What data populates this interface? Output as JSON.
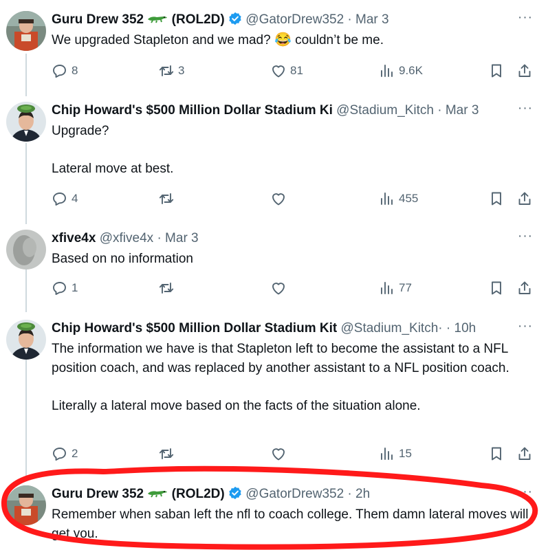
{
  "tweets": [
    {
      "name": "Guru Drew 352",
      "handle_suffix": "(ROL2D)",
      "handle": "@GatorDrew352",
      "time": "· Mar 3",
      "text_before_emoji": "We upgraded Stapleton and we mad? ",
      "emoji": "😂",
      "text_after_emoji": " couldn’t be me.",
      "replies": "8",
      "reposts": "3",
      "likes": "81",
      "views": "9.6K"
    },
    {
      "name": "Chip Howard's $500 Million Dollar Stadium Ki",
      "handle": "@Stadium_Kitch",
      "time": "· Mar 3",
      "text": "Upgrade?\n\nLateral move at best.",
      "replies": "4",
      "reposts": "",
      "likes": "",
      "views": "455"
    },
    {
      "name": "xfive4x",
      "handle": "@xfive4x",
      "time": "· Mar 3",
      "text": "Based on no information",
      "replies": "1",
      "reposts": "",
      "likes": "",
      "views": "77"
    },
    {
      "name": "Chip Howard's $500 Million Dollar Stadium Kit",
      "handle": "@Stadium_Kitch·",
      "time": "· 10h",
      "text": "The information we have is that Stapleton left to become the assistant to a NFL position coach, and was replaced by another assistant to a NFL position coach.\n\nLiterally a lateral move based on the facts of the situation alone.",
      "replies": "2",
      "reposts": "",
      "likes": "",
      "views": "15"
    },
    {
      "name": "Guru Drew 352",
      "handle_suffix": "(ROL2D)",
      "handle": "@GatorDrew352",
      "time": "· 2h",
      "text": "Remember when saban left the nfl to coach college. Them damn lateral moves will get you."
    }
  ],
  "more_label": "···",
  "icons": {
    "reply": "reply-icon",
    "repost": "repost-icon",
    "like": "heart-icon",
    "views": "views-icon",
    "bookmark": "bookmark-icon",
    "share": "share-icon",
    "verified": "verified-badge-icon",
    "gator": "alligator-emoji-icon"
  },
  "colors": {
    "text": "#0f1419",
    "secondary": "#536471",
    "verified": "#1d9bf0",
    "thread_line": "#cfd9de",
    "annotation": "#ff1a1a"
  }
}
